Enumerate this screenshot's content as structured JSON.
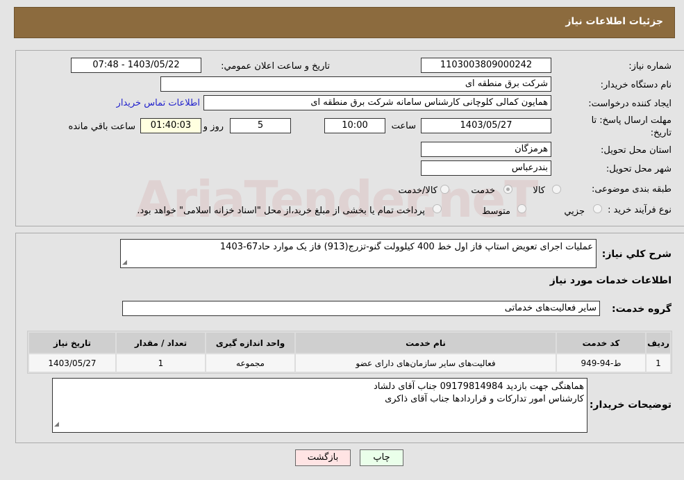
{
  "header": {
    "title": "جزئیات اطلاعات نیاز"
  },
  "watermark": "AriaTender.neT",
  "form": {
    "need_number_label": "شماره نیاز:",
    "need_number": "1103003809000242",
    "announce_label": "تاریخ و ساعت اعلان عمومي:",
    "announce_value": "1403/05/22 - 07:48",
    "buyer_org_label": "نام دستگاه خریدار:",
    "buyer_org": "شرکت برق منطقه ای",
    "creator_label": "ایجاد کننده درخواست:",
    "creator": "همایون کمالی کلوچانی کارشناس سامانه شرکت برق منطقه ای",
    "contact_link": "اطلاعات تماس خریدار",
    "deadline_label": "مهلت ارسال پاسخ: تا تاریخ:",
    "deadline_date": "1403/05/27",
    "time_label": "ساعت",
    "deadline_time": "10:00",
    "days": "5",
    "days_label": "روز و",
    "remaining": "01:40:03",
    "remaining_label": "ساعت باقي مانده",
    "province_label": "استان محل تحویل:",
    "province": "هرمزگان",
    "city_label": "شهر محل تحویل:",
    "city": "بندرعباس",
    "category_label": "طبقه بندی موضوعی:",
    "category_options": [
      "کالا",
      "خدمت",
      "کالا/خدمت"
    ],
    "category_selected": "خدمت",
    "process_label": "نوع فرآیند خرید :",
    "process_options": [
      "جزیي",
      "متوسط"
    ],
    "process_note": "پرداخت تمام یا بخشی از مبلغ خرید،از محل \"اسناد خزانه اسلامی\" خواهد بود."
  },
  "details": {
    "summary_label": "شرح کلي نیاز:",
    "summary": "عملیات اجرای تعویض استاپ فاز اول خط 400 کیلوولت گنو-تزرج(913) فاز یک موارد حاد67-1403",
    "services_heading": "اطلاعات خدمات مورد نیاز",
    "group_label": "گروه خدمت:",
    "group": "سایر فعالیت‌های خدماتی",
    "table": {
      "headers": [
        "ردیف",
        "کد خدمت",
        "نام خدمت",
        "واحد اندازه گیری",
        "تعداد / مقدار",
        "تاریخ نیاز"
      ],
      "rows": [
        [
          "1",
          "ط-94-949",
          "فعالیت‌های سایر سازمان‌های دارای عضو",
          "مجموعه",
          "1",
          "1403/05/27"
        ]
      ]
    },
    "notes_label": "توضیحات خریدار:",
    "notes_line1": "هماهنگی جهت بازدید 09179814984 جناب آقای دلشاد",
    "notes_line2": "کارشناس امور تدارکات و قراردادها جناب آقای ذاکری"
  },
  "buttons": {
    "print": "چاپ",
    "back": "بازگشت"
  }
}
